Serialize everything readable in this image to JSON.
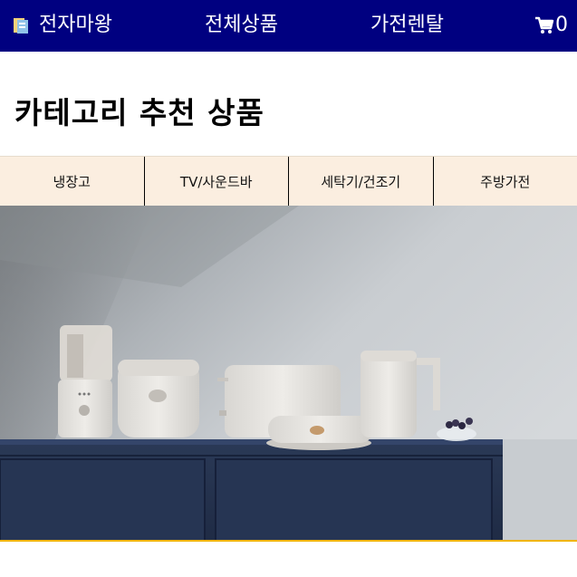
{
  "header": {
    "brand_name": "전자마왕",
    "brand_icon": "book-icon",
    "nav": [
      {
        "label": "전체상품"
      },
      {
        "label": "가전렌탈"
      }
    ],
    "cart_icon": "cart-icon",
    "cart_count": "0",
    "bg_color": "#000080"
  },
  "main": {
    "section_title": "카테고리 추천 상품",
    "tabs": [
      {
        "label": "냉장고"
      },
      {
        "label": "TV/사운드바"
      },
      {
        "label": "세탁기/건조기"
      },
      {
        "label": "주방가전"
      }
    ],
    "tab_bg_color": "#fbeee0",
    "hero_image": "kitchen-appliances-photo",
    "hero_accent_color": "#f0b400"
  }
}
